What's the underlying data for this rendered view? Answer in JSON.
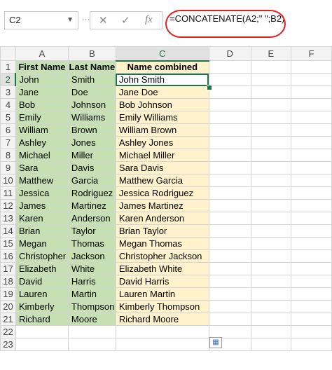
{
  "namebox": {
    "value": "C2"
  },
  "toolbar": {
    "cancel": "✕",
    "enter": "✓",
    "fx": "fx"
  },
  "formula": {
    "text": "=CONCATENATE(A2;\" \";B2)"
  },
  "columns": [
    "A",
    "B",
    "C",
    "D",
    "E",
    "F"
  ],
  "active_cell": "C2",
  "header_row": {
    "a": "First Name",
    "b": "Last Name",
    "c": "Name combined"
  },
  "rows": [
    {
      "num": "1"
    },
    {
      "num": "2",
      "a": "John",
      "b": "Smith",
      "c": "John Smith"
    },
    {
      "num": "3",
      "a": "Jane",
      "b": "Doe",
      "c": "Jane Doe"
    },
    {
      "num": "4",
      "a": "Bob",
      "b": "Johnson",
      "c": "Bob Johnson"
    },
    {
      "num": "5",
      "a": "Emily",
      "b": "Williams",
      "c": "Emily Williams"
    },
    {
      "num": "6",
      "a": "William",
      "b": "Brown",
      "c": "William Brown"
    },
    {
      "num": "7",
      "a": "Ashley",
      "b": "Jones",
      "c": "Ashley Jones"
    },
    {
      "num": "8",
      "a": "Michael",
      "b": "Miller",
      "c": "Michael Miller"
    },
    {
      "num": "9",
      "a": "Sara",
      "b": "Davis",
      "c": "Sara Davis"
    },
    {
      "num": "10",
      "a": "Matthew",
      "b": "Garcia",
      "c": "Matthew Garcia"
    },
    {
      "num": "11",
      "a": "Jessica",
      "b": "Rodriguez",
      "c": "Jessica Rodriguez"
    },
    {
      "num": "12",
      "a": "James",
      "b": "Martinez",
      "c": "James Martinez"
    },
    {
      "num": "13",
      "a": "Karen",
      "b": "Anderson",
      "c": "Karen Anderson"
    },
    {
      "num": "14",
      "a": "Brian",
      "b": "Taylor",
      "c": "Brian Taylor"
    },
    {
      "num": "15",
      "a": "Megan",
      "b": "Thomas",
      "c": "Megan Thomas"
    },
    {
      "num": "16",
      "a": "Christopher",
      "b": "Jackson",
      "c": "Christopher Jackson"
    },
    {
      "num": "17",
      "a": "Elizabeth",
      "b": "White",
      "c": "Elizabeth White"
    },
    {
      "num": "18",
      "a": "David",
      "b": "Harris",
      "c": "David Harris"
    },
    {
      "num": "19",
      "a": "Lauren",
      "b": "Martin",
      "c": "Lauren Martin"
    },
    {
      "num": "20",
      "a": "Kimberly",
      "b": "Thompson",
      "c": "Kimberly Thompson"
    },
    {
      "num": "21",
      "a": "Richard",
      "b": "Moore",
      "c": "Richard Moore"
    },
    {
      "num": "22"
    },
    {
      "num": "23"
    }
  ],
  "colors": {
    "green_fill": "#c6e0b4",
    "yellow_fill": "#fff2cc",
    "excel_green": "#217346",
    "highlight_circle": "#e02020"
  },
  "icons": {
    "paste_options": "paste-options-icon"
  }
}
